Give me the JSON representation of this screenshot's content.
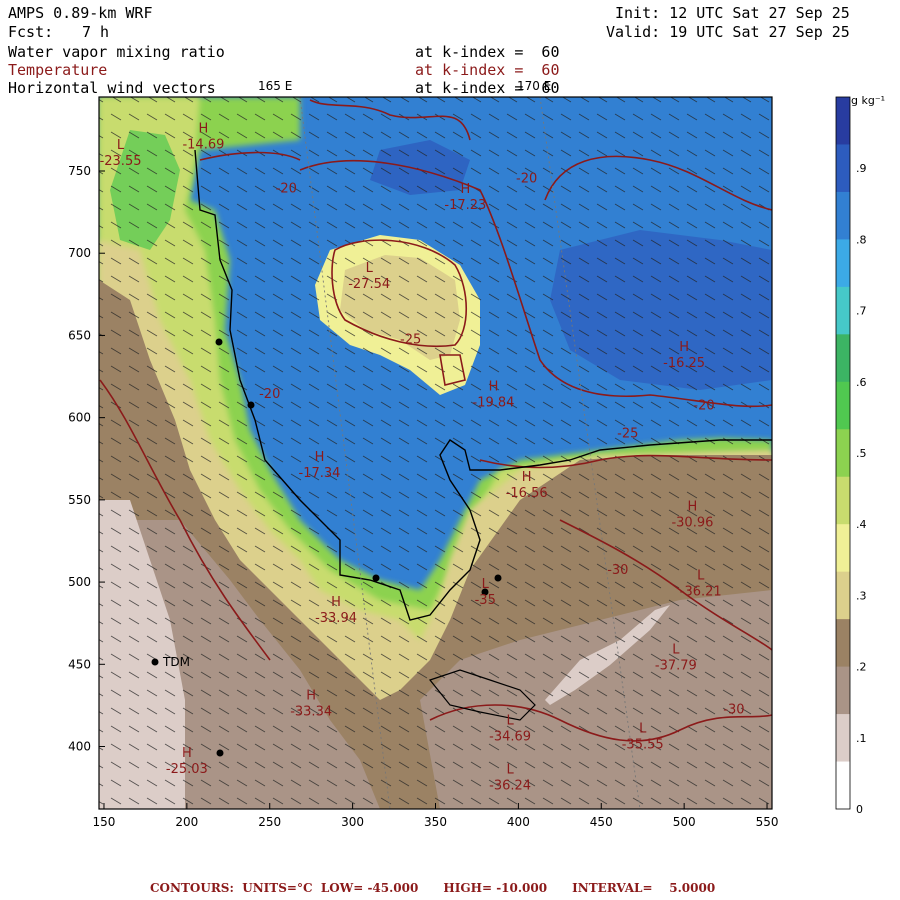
{
  "header": {
    "model": "AMPS 0.89-km WRF",
    "forecast_label": "Fcst:",
    "forecast_value": "7 h",
    "init": "Init: 12 UTC Sat 27 Sep 25",
    "valid": "Valid: 19 UTC Sat 27 Sep 25",
    "fields": [
      {
        "name": "Water vapor mixing ratio",
        "level": "at k-index =  60",
        "color": "#000000"
      },
      {
        "name": "Temperature",
        "level": "at k-index =  60",
        "color": "#8b1a1a"
      },
      {
        "name": "Horizontal wind vectors",
        "level": "at k-index =  60",
        "color": "#000000"
      }
    ]
  },
  "map": {
    "meridian_labels": [
      "165 E",
      "170 E"
    ],
    "x_ticks": [
      150,
      200,
      250,
      300,
      350,
      400,
      450,
      500,
      550
    ],
    "y_ticks": [
      750,
      700,
      650,
      600,
      550,
      500,
      450,
      400
    ],
    "x_range": [
      147,
      553
    ],
    "y_range": [
      362,
      795
    ],
    "station_label": "TDM",
    "extrema": [
      {
        "type": "L",
        "value": "-27.54",
        "x": 310,
        "y": 680
      },
      {
        "type": "H",
        "value": "-17.23",
        "x": 368,
        "y": 728
      },
      {
        "type": "H",
        "value": "-14.69",
        "x": 210,
        "y": 765
      },
      {
        "type": "L",
        "value": "-23.55",
        "x": 160,
        "y": 755
      },
      {
        "type": "H",
        "value": "-16.25",
        "x": 500,
        "y": 632
      },
      {
        "type": "H",
        "value": "-19.84",
        "x": 385,
        "y": 608
      },
      {
        "type": "H",
        "value": "-17.34",
        "x": 280,
        "y": 565
      },
      {
        "type": "H",
        "value": "-16.56",
        "x": 405,
        "y": 553
      },
      {
        "type": "H",
        "value": "-30.96",
        "x": 505,
        "y": 535
      },
      {
        "type": "L",
        "value": "-36.21",
        "x": 510,
        "y": 493
      },
      {
        "type": "L",
        "value": "-35",
        "x": 380,
        "y": 488
      },
      {
        "type": "L",
        "value": "-37.79",
        "x": 495,
        "y": 448
      },
      {
        "type": "L",
        "value": "-35.55",
        "x": 475,
        "y": 400
      },
      {
        "type": "L",
        "value": "-34.69",
        "x": 395,
        "y": 405
      },
      {
        "type": "L",
        "value": "-36.24",
        "x": 395,
        "y": 375
      },
      {
        "type": "H",
        "value": "-33.94",
        "x": 290,
        "y": 477
      },
      {
        "type": "H",
        "value": "-33.34",
        "x": 275,
        "y": 420
      },
      {
        "type": "H",
        "value": "-25.03",
        "x": 200,
        "y": 385
      }
    ],
    "contour_labels": [
      {
        "value": "-20",
        "x": 260,
        "y": 737
      },
      {
        "value": "-20",
        "x": 405,
        "y": 743
      },
      {
        "value": "-25",
        "x": 335,
        "y": 645
      },
      {
        "value": "-20",
        "x": 250,
        "y": 612
      },
      {
        "value": "-20",
        "x": 512,
        "y": 605
      },
      {
        "value": "-25",
        "x": 466,
        "y": 588
      },
      {
        "value": "-30",
        "x": 460,
        "y": 505
      },
      {
        "value": "-30",
        "x": 530,
        "y": 420
      }
    ]
  },
  "colorbar": {
    "unit": "g kg⁻¹",
    "labels": [
      ".9",
      ".8",
      ".7",
      ".6",
      ".5",
      ".4",
      ".3",
      ".2",
      ".1",
      "0"
    ],
    "colors": [
      "#283ca0",
      "#2d5cbe",
      "#3280d2",
      "#3caae6",
      "#46c8c8",
      "#3cb464",
      "#50c850",
      "#8cd250",
      "#c8dc6e",
      "#f0f096",
      "#dcd08c",
      "#9b8264",
      "#aa9487",
      "#dccdc8",
      "#ffffff"
    ]
  },
  "footer": {
    "contours": "CONTOURS:  UNITS=°C  LOW= -45.000      HIGH= -10.000      INTERVAL=    5.0000"
  }
}
